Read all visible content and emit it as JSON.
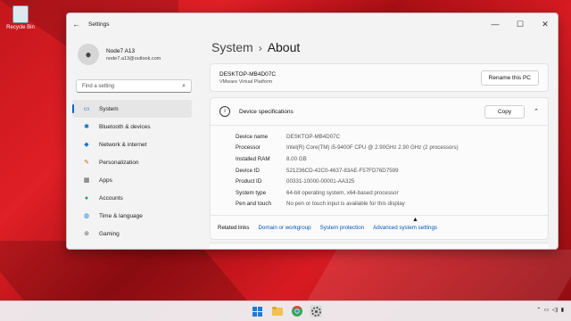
{
  "desktop": {
    "recycle_bin_label": "Recycle Bin"
  },
  "window": {
    "title": "Settings",
    "controls": {
      "minimize": "—",
      "maximize": "☐",
      "close": "✕"
    }
  },
  "profile": {
    "name": "Node7 A13",
    "email": "node7.a13@outlook.com"
  },
  "search": {
    "placeholder": "Find a setting"
  },
  "nav": {
    "items": [
      {
        "label": "System",
        "icon": "monitor-icon"
      },
      {
        "label": "Bluetooth & devices",
        "icon": "bluetooth-icon"
      },
      {
        "label": "Network & internet",
        "icon": "wifi-icon"
      },
      {
        "label": "Personalization",
        "icon": "brush-icon"
      },
      {
        "label": "Apps",
        "icon": "apps-icon"
      },
      {
        "label": "Accounts",
        "icon": "person-icon"
      },
      {
        "label": "Time & language",
        "icon": "globe-clock-icon"
      },
      {
        "label": "Gaming",
        "icon": "controller-icon"
      }
    ],
    "active_index": 0
  },
  "page": {
    "crumb": "System",
    "separator": "›",
    "title": "About"
  },
  "pc": {
    "device_name": "DESKTOP-MB4D07C",
    "platform": "VMware Virtual Platform",
    "rename_button": "Rename this PC"
  },
  "specs": {
    "title": "Device specifications",
    "copy_button": "Copy",
    "rows": [
      {
        "key": "Device name",
        "value": "DESKTOP-MB4D07C"
      },
      {
        "key": "Processor",
        "value": "Intel(R) Core(TM) i5-9400F CPU @ 2.90GHz   2.90 GHz  (2 processors)"
      },
      {
        "key": "Installed RAM",
        "value": "8.00 GB"
      },
      {
        "key": "Device ID",
        "value": "521236CD-42C0-4637-83AE-F57FD76D7599"
      },
      {
        "key": "Product ID",
        "value": "00331-10000-00001-AA325"
      },
      {
        "key": "System type",
        "value": "64-bit operating system, x64-based processor"
      },
      {
        "key": "Pen and touch",
        "value": "No pen or touch input is available for this display"
      }
    ]
  },
  "related": {
    "label": "Related links",
    "links": [
      "Domain or workgroup",
      "System protection",
      "Advanced system settings"
    ]
  },
  "colors": {
    "accent": "#0067c0",
    "link": "#0057b8",
    "wallpaper": "#d81b22"
  },
  "taskbar": {
    "icons": [
      "windows-start-icon",
      "file-explorer-icon",
      "chrome-icon",
      "settings-gear-icon"
    ]
  }
}
